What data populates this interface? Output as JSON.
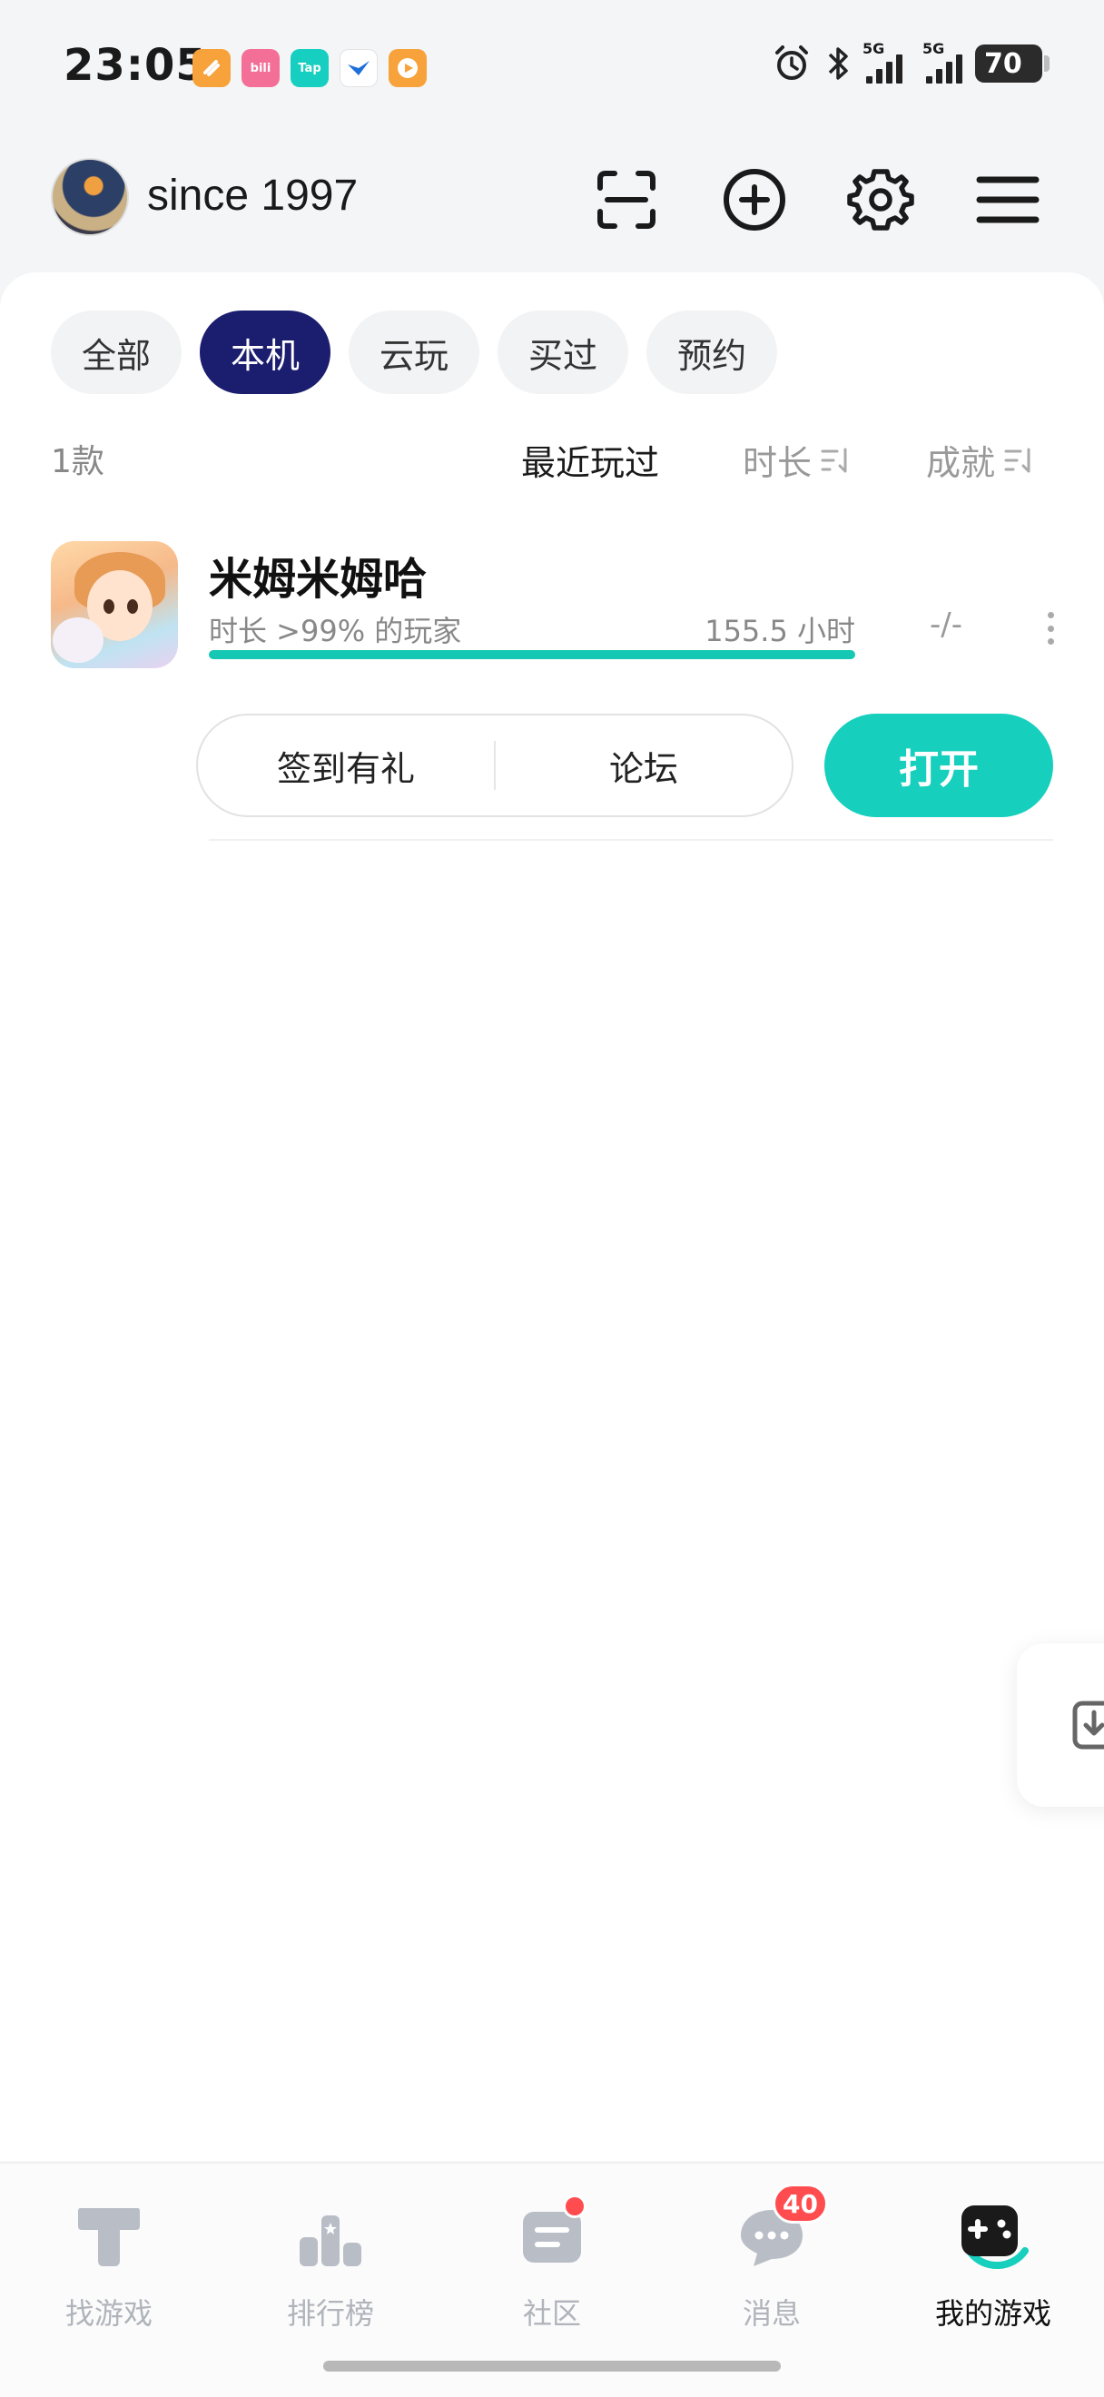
{
  "status_bar": {
    "time": "23:05",
    "notification_icons": [
      {
        "name": "app-orange-icon",
        "color": "#f7a23b",
        "label": ""
      },
      {
        "name": "bilibili-icon",
        "color": "#f36f97",
        "label": "bili"
      },
      {
        "name": "taptap-icon",
        "color": "#17cfc0",
        "label": "Tap"
      },
      {
        "name": "app-blue-bird-icon",
        "color": "#ffffff",
        "label": ""
      },
      {
        "name": "video-app-icon",
        "color": "#f7a23b",
        "label": ""
      }
    ],
    "signal1_label": "5G",
    "signal2_label": "5G",
    "battery": "70"
  },
  "header": {
    "username": "since 1997"
  },
  "filters": [
    {
      "label": "全部",
      "active": false
    },
    {
      "label": "本机",
      "active": true
    },
    {
      "label": "云玩",
      "active": false
    },
    {
      "label": "买过",
      "active": false
    },
    {
      "label": "预约",
      "active": false
    }
  ],
  "sort": {
    "count": "1款",
    "recent": "最近玩过",
    "duration": "时长",
    "achievement": "成就"
  },
  "game": {
    "title": "米姆米姆哈",
    "playtime_label": "时长 >99% 的玩家",
    "playtime_value": "155.5 小时",
    "progress": 1.0,
    "achievement": "-/-",
    "checkin_label": "签到有礼",
    "forum_label": "论坛",
    "open_label": "打开"
  },
  "nav": {
    "items": [
      {
        "label": "找游戏"
      },
      {
        "label": "排行榜"
      },
      {
        "label": "社区"
      },
      {
        "label": "消息",
        "badge": "40"
      },
      {
        "label": "我的游戏"
      }
    ]
  },
  "colors": {
    "accent_teal": "#16cfbd",
    "active_chip": "#1b1d6e",
    "badge_red": "#ff4d4f"
  }
}
